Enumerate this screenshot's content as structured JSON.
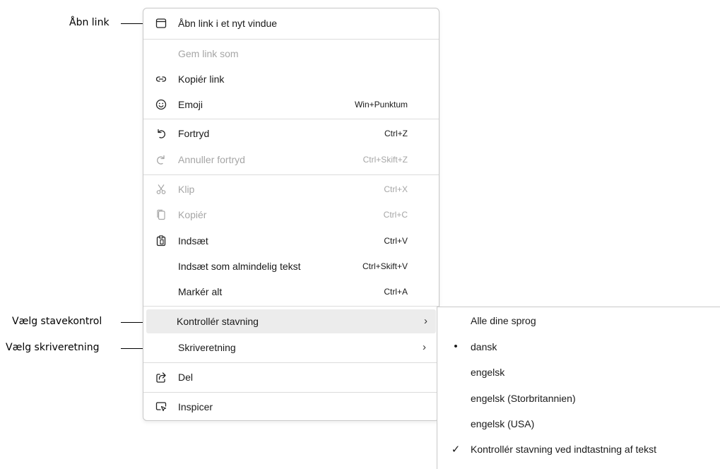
{
  "callouts": {
    "open_link": "Åbn link",
    "spellcheck": "Vælg stavekontrol",
    "writing_direction": "Vælg skriveretning"
  },
  "menu": {
    "open_new_window": "Åbn link i et nyt vindue",
    "save_link_as": "Gem link som",
    "copy_link": "Kopiér link",
    "emoji": {
      "label": "Emoji",
      "shortcut": "Win+Punktum"
    },
    "undo": {
      "label": "Fortryd",
      "shortcut": "Ctrl+Z"
    },
    "redo": {
      "label": "Annuller fortryd",
      "shortcut": "Ctrl+Skift+Z"
    },
    "cut": {
      "label": "Klip",
      "shortcut": "Ctrl+X"
    },
    "copy": {
      "label": "Kopiér",
      "shortcut": "Ctrl+C"
    },
    "paste": {
      "label": "Indsæt",
      "shortcut": "Ctrl+V"
    },
    "paste_plain": {
      "label": "Indsæt som almindelig tekst",
      "shortcut": "Ctrl+Skift+V"
    },
    "select_all": {
      "label": "Markér alt",
      "shortcut": "Ctrl+A"
    },
    "spellcheck": "Kontrollér stavning",
    "writing_direction": "Skriveretning",
    "share": "Del",
    "inspect": "Inspicer",
    "chevron": "›"
  },
  "submenu": {
    "all_languages": "Alle dine sprog",
    "danish": "dansk",
    "english": "engelsk",
    "english_uk": "engelsk (Storbritannien)",
    "english_us": "engelsk (USA)",
    "check_while_typing": "Kontrollér stavning ved indtastning af tekst",
    "bullet": "•",
    "check": "✓"
  },
  "colors": {
    "disabled_text": "#a6a6a6",
    "hover_background": "#ececec",
    "separator": "#dcdcdc"
  }
}
